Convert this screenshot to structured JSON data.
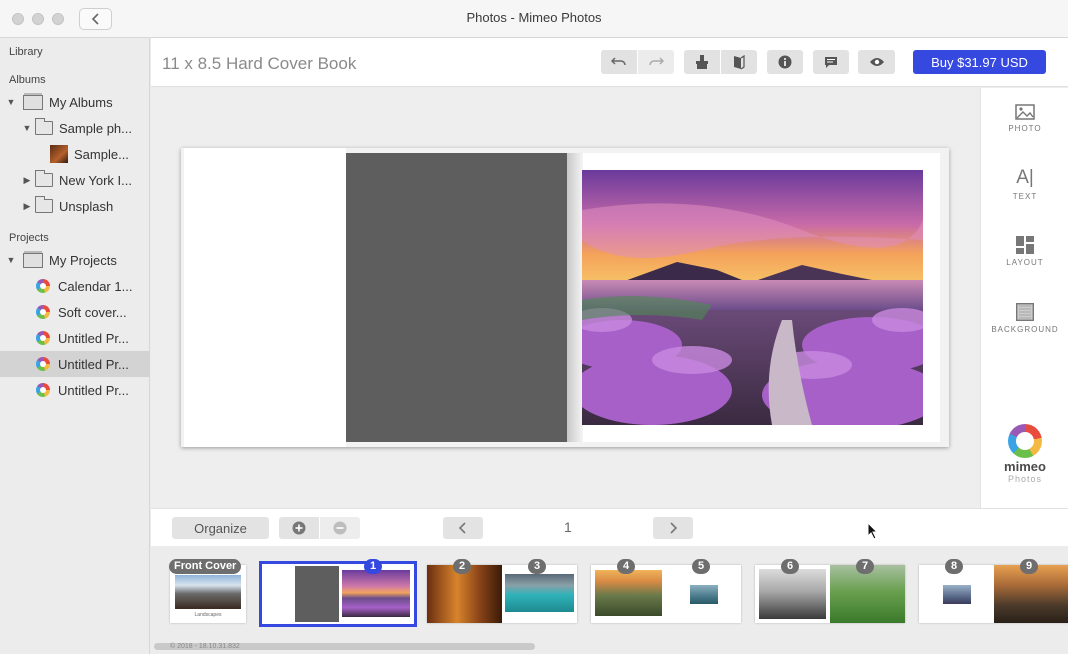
{
  "window": {
    "title": "Photos - Mimeo Photos"
  },
  "sidebar": {
    "library_header": "Library",
    "albums_header": "Albums",
    "projects_header": "Projects",
    "albums": [
      {
        "label": "My Albums"
      },
      {
        "label": "Sample ph..."
      },
      {
        "label": "Sample..."
      },
      {
        "label": "New York I..."
      },
      {
        "label": "Unsplash"
      }
    ],
    "projects": [
      {
        "label": "My Projects"
      },
      {
        "label": "Calendar 1..."
      },
      {
        "label": "Soft cover..."
      },
      {
        "label": "Untitled Pr..."
      },
      {
        "label": "Untitled Pr..."
      },
      {
        "label": "Untitled Pr..."
      }
    ]
  },
  "toolbar": {
    "book_title": "11 x 8.5 Hard Cover Book",
    "buy_label": "Buy $31.97 USD"
  },
  "tools": {
    "photo": "PHOTO",
    "text": "TEXT",
    "layout": "LAYOUT",
    "background": "BACKGROUND",
    "brand": "mimeo",
    "brand_sub": "Photos"
  },
  "bottombar": {
    "organize_label": "Organize",
    "current_page": "1"
  },
  "filmstrip": {
    "front_cover_label": "Front Cover",
    "cover_caption": "Landscapes",
    "badges": [
      "1",
      "2",
      "3",
      "4",
      "5",
      "6",
      "7",
      "8",
      "9"
    ],
    "footnote": "© 2018 - 18.10.31.832"
  },
  "colors": {
    "accent": "#3548e0",
    "selected_row": "#d3d3d3"
  }
}
